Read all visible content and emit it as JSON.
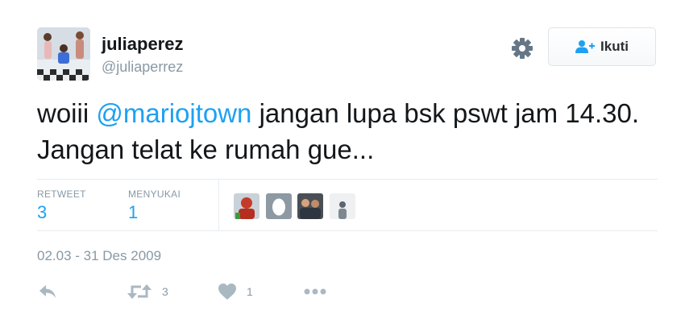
{
  "user": {
    "display_name": "juliaperez",
    "screen_name": "@juliaperrez"
  },
  "follow_button": {
    "label": "Ikuti"
  },
  "tweet": {
    "text_before": "woiii ",
    "mention": "@mariojtown",
    "text_after": " jangan lupa bsk pswt jam 14.30. Jangan telat ke rumah gue...",
    "timestamp": "02.03 - 31 Des 2009"
  },
  "stats": {
    "retweet_label": "RETWEET",
    "retweet_count": "3",
    "like_label": "MENYUKAI",
    "like_count": "1"
  },
  "likers": [
    {
      "icon": "user-avatar-red"
    },
    {
      "icon": "egg-avatar"
    },
    {
      "icon": "user-avatar-group"
    },
    {
      "icon": "user-avatar-light"
    }
  ],
  "actions": {
    "retweet_count": "3",
    "like_count": "1"
  },
  "colors": {
    "accent": "#1da1f2",
    "muted": "#8899a6",
    "icon": "#aab8c2"
  }
}
